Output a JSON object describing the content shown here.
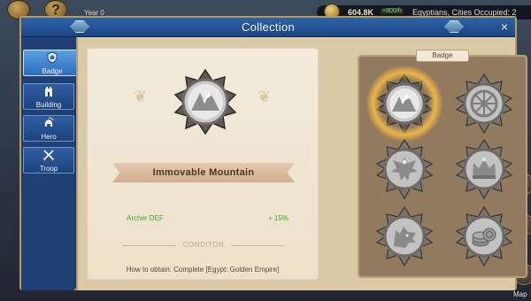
{
  "hud": {
    "year": "Year 0",
    "gold": "604.8K",
    "gold_rate": "+800/h",
    "civ_text": "Egyptians, Cities Occupied: 2"
  },
  "edge_labels": [
    "tion",
    "ree",
    "Map"
  ],
  "modal": {
    "title": "Collection",
    "close_label": "×"
  },
  "tabs": [
    {
      "label": "Badge",
      "icon": "shield-icon",
      "active": true
    },
    {
      "label": "Building",
      "icon": "tower-icon",
      "active": false
    },
    {
      "label": "Hero",
      "icon": "helmet-icon",
      "active": false
    },
    {
      "label": "Troop",
      "icon": "swords-icon",
      "active": false
    }
  ],
  "detail": {
    "name": "Immovable Mountain",
    "bonus_label": "Archer DEF",
    "bonus_value": "+ 15%",
    "condition_title": "CONDITON",
    "obtain_text": "How to obtain: Complete [Egypt: Golden Empire]"
  },
  "grid": {
    "tag": "Badge",
    "badges": [
      {
        "icon": "mountain-badge-icon",
        "selected": true
      },
      {
        "icon": "wheel-badge-icon",
        "selected": false
      },
      {
        "icon": "eagle-badge-icon",
        "selected": false
      },
      {
        "icon": "crown-badge-icon",
        "selected": false
      },
      {
        "icon": "wolf-badge-icon",
        "selected": false
      },
      {
        "icon": "coins-badge-icon",
        "selected": false
      }
    ]
  },
  "colors": {
    "bonus_green": "#3aa836",
    "frame_blue": "#1d3a6e",
    "parchment": "#f3eadb",
    "glow": "#ffbe46"
  }
}
